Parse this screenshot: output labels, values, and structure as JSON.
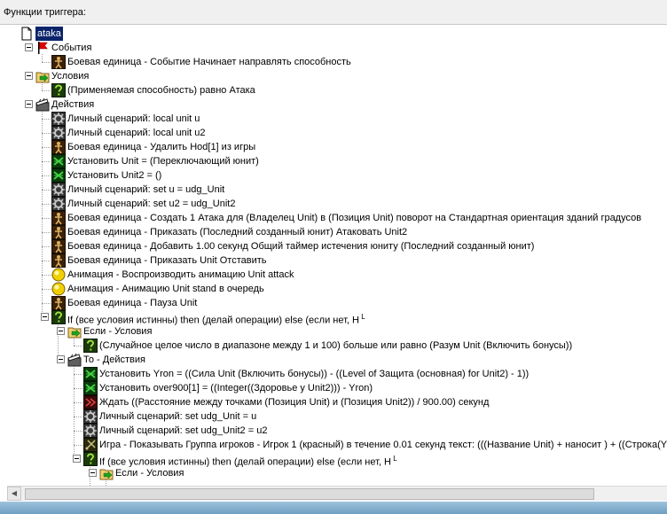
{
  "header": {
    "title": "Функции триггера:"
  },
  "rows": [
    {
      "d": 0,
      "icon": "document-icon",
      "text": "ataka",
      "sel": true,
      "exp": false
    },
    {
      "d": 1,
      "icon": "flag-icon",
      "text": "События",
      "exp": true
    },
    {
      "d": 2,
      "icon": "unit-icon",
      "text": "Боевая единица - Событие Начинает направлять способность"
    },
    {
      "d": 1,
      "icon": "condition-folder-icon",
      "text": "Условия",
      "exp": true
    },
    {
      "d": 2,
      "icon": "question-icon",
      "text": "(Применяемая способность) равно Атака"
    },
    {
      "d": 1,
      "icon": "clapper-icon",
      "text": "Действия",
      "exp": true
    },
    {
      "d": 2,
      "icon": "script-icon",
      "text": "Личный сценарий:   local unit u"
    },
    {
      "d": 2,
      "icon": "script-icon",
      "text": "Личный сценарий:   local unit u2"
    },
    {
      "d": 2,
      "icon": "unit-icon",
      "text": "Боевая единица - Удалить Hod[1] из игры"
    },
    {
      "d": 2,
      "icon": "set-variable-icon",
      "text": "Установить Unit = (Переключающий юнит)"
    },
    {
      "d": 2,
      "icon": "set-variable-icon",
      "text": "Установить Unit2 = ()"
    },
    {
      "d": 2,
      "icon": "script-icon",
      "text": "Личный сценарий:   set u = udg_Unit"
    },
    {
      "d": 2,
      "icon": "script-icon",
      "text": "Личный сценарий:   set u2 = udg_Unit2"
    },
    {
      "d": 2,
      "icon": "unit-icon",
      "text": "Боевая единица - Создать 1 Атака для (Владелец Unit) в (Позиция Unit) поворот на Стандартная ориентация зданий градусов"
    },
    {
      "d": 2,
      "icon": "unit-icon",
      "text": "Боевая единица - Приказать (Последний созданный юнит) Атаковать Unit2"
    },
    {
      "d": 2,
      "icon": "unit-icon",
      "text": "Боевая единица - Добавить 1.00 секунд Общий таймер истечения юниту (Последний созданный юнит)"
    },
    {
      "d": 2,
      "icon": "unit-icon",
      "text": "Боевая единица - Приказать Unit Отставить"
    },
    {
      "d": 2,
      "icon": "animation-icon",
      "text": "Анимация - Воспроизводить анимацию Unit attack"
    },
    {
      "d": 2,
      "icon": "animation-icon",
      "text": "Анимация - Анимацию Unit stand в очередь"
    },
    {
      "d": 2,
      "icon": "unit-icon",
      "text": "Боевая единица - Пауза Unit"
    },
    {
      "d": 2,
      "icon": "question-icon",
      "text": "If (все условия истинны) then (делай операции) else (если нет, Н",
      "exp": true,
      "tick": "L"
    },
    {
      "d": 3,
      "icon": "condition-folder-icon",
      "text": "Если - Условия",
      "exp": true
    },
    {
      "d": 4,
      "icon": "question-icon",
      "text": "(Случайное целое число в диапазоне между 1 и 100) больше или равно (Разум Unit (Включить бонусы))"
    },
    {
      "d": 3,
      "icon": "clapper-icon",
      "text": "То - Действия",
      "exp": true
    },
    {
      "d": 4,
      "icon": "set-variable-icon",
      "text": "Установить Yron = ((Сила Unit (Включить бонусы)) - ((Level of Защита (основная) for Unit2) - 1))"
    },
    {
      "d": 4,
      "icon": "set-variable-icon",
      "text": "Установить over900[1] = ((Integer((Здоровье у Unit2))) - Yron)"
    },
    {
      "d": 4,
      "icon": "wait-icon",
      "text": "Ждать ((Расстояние между точками (Позиция Unit) и (Позиция Unit2)) / 900.00) секунд"
    },
    {
      "d": 4,
      "icon": "script-icon",
      "text": "Личный сценарий:   set udg_Unit = u"
    },
    {
      "d": 4,
      "icon": "script-icon",
      "text": "Личный сценарий:   set udg_Unit2 = u2"
    },
    {
      "d": 4,
      "icon": "game-icon",
      "text": "Игра - Показывать Группа игроков - Игрок 1 (красный) в течение 0.01 секунд текст: (((Название Unit) +  наносит ) + ((Строка(Yr"
    },
    {
      "d": 4,
      "icon": "question-icon",
      "text": "If (все условия истинны) then (делай операции) else (если нет, Н",
      "exp": true,
      "tick": "L"
    },
    {
      "d": 5,
      "icon": "condition-folder-icon",
      "text": "Если - Условия",
      "exp": true
    }
  ]
}
